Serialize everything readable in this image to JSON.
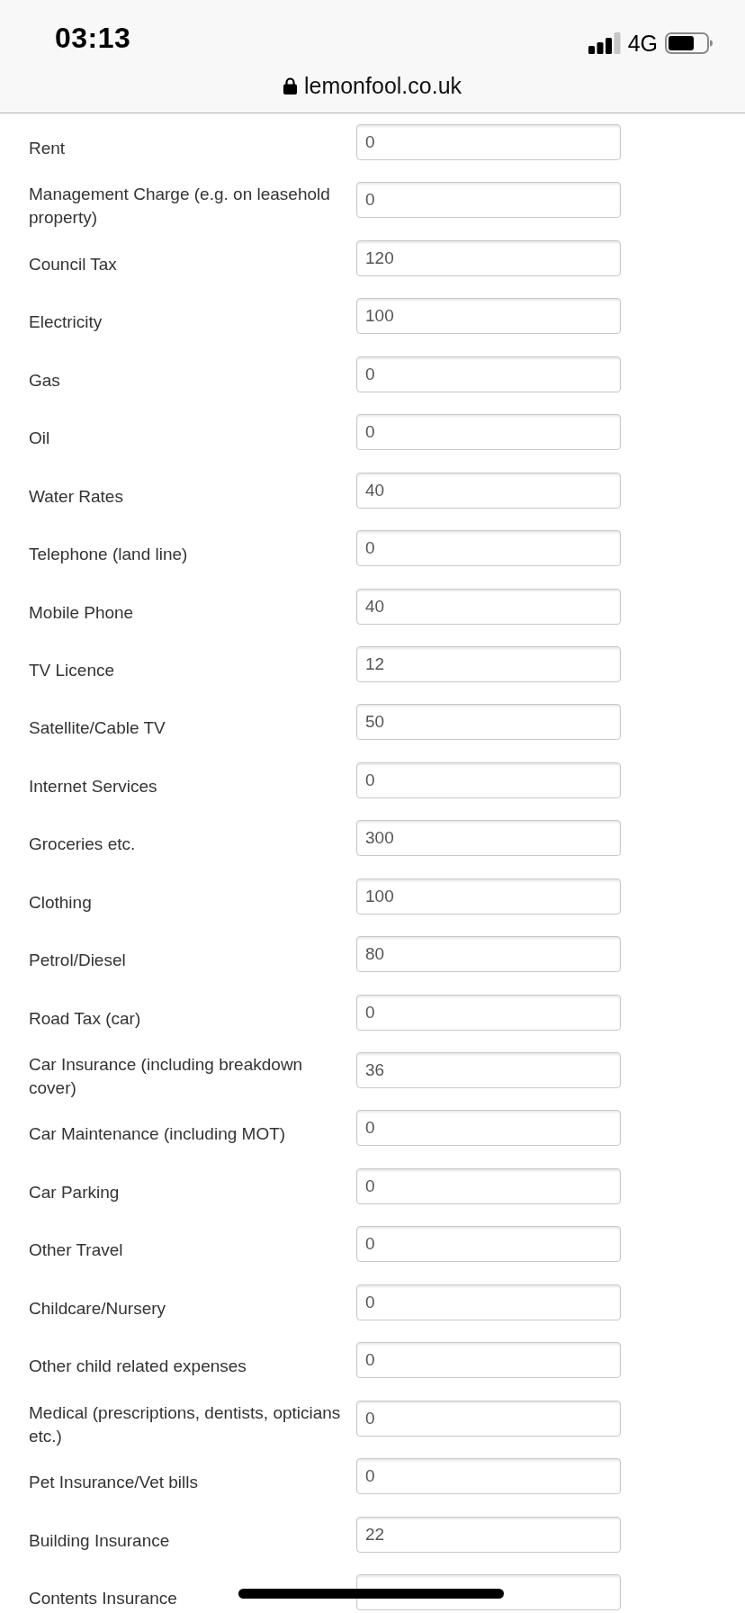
{
  "status_bar": {
    "time": "03:13",
    "network": "4G"
  },
  "address_bar": {
    "url": "lemonfool.co.uk"
  },
  "form_rows": [
    {
      "label": "Rent",
      "value": "0"
    },
    {
      "label": "Management Charge (e.g. on leasehold property)",
      "value": "0"
    },
    {
      "label": "Council Tax",
      "value": "120"
    },
    {
      "label": "Electricity",
      "value": "100"
    },
    {
      "label": "Gas",
      "value": "0"
    },
    {
      "label": "Oil",
      "value": "0"
    },
    {
      "label": "Water Rates",
      "value": "40"
    },
    {
      "label": "Telephone (land line)",
      "value": "0"
    },
    {
      "label": "Mobile Phone",
      "value": "40"
    },
    {
      "label": "TV Licence",
      "value": "12"
    },
    {
      "label": "Satellite/Cable TV",
      "value": "50"
    },
    {
      "label": "Internet Services",
      "value": "0"
    },
    {
      "label": "Groceries etc.",
      "value": "300"
    },
    {
      "label": "Clothing",
      "value": "100"
    },
    {
      "label": "Petrol/Diesel",
      "value": "80"
    },
    {
      "label": "Road Tax (car)",
      "value": "0"
    },
    {
      "label": "Car Insurance (including breakdown cover)",
      "value": "36"
    },
    {
      "label": "Car Maintenance (including MOT)",
      "value": "0"
    },
    {
      "label": "Car Parking",
      "value": "0"
    },
    {
      "label": "Other Travel",
      "value": "0"
    },
    {
      "label": "Childcare/Nursery",
      "value": "0"
    },
    {
      "label": "Other child related expenses",
      "value": "0"
    },
    {
      "label": "Medical (prescriptions, dentists, opticians etc.)",
      "value": "0"
    },
    {
      "label": "Pet Insurance/Vet bills",
      "value": "0"
    },
    {
      "label": "Building Insurance",
      "value": "22"
    },
    {
      "label": "Contents Insurance"
    }
  ]
}
